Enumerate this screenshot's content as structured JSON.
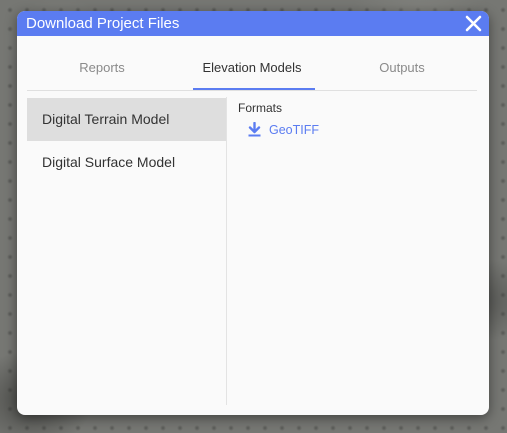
{
  "dialog": {
    "title": "Download Project Files",
    "close_icon": "close-icon"
  },
  "tabs": [
    {
      "label": "Reports",
      "active": false
    },
    {
      "label": "Elevation Models",
      "active": true
    },
    {
      "label": "Outputs",
      "active": false
    }
  ],
  "models": [
    {
      "label": "Digital Terrain Model",
      "selected": true
    },
    {
      "label": "Digital Surface Model",
      "selected": false
    }
  ],
  "formats": {
    "heading": "Formats",
    "items": [
      {
        "label": "GeoTIFF",
        "icon": "download-icon"
      }
    ]
  },
  "colors": {
    "accent": "#5b7cf1",
    "selected_bg": "#dedede",
    "panel_bg": "#fafafa"
  }
}
